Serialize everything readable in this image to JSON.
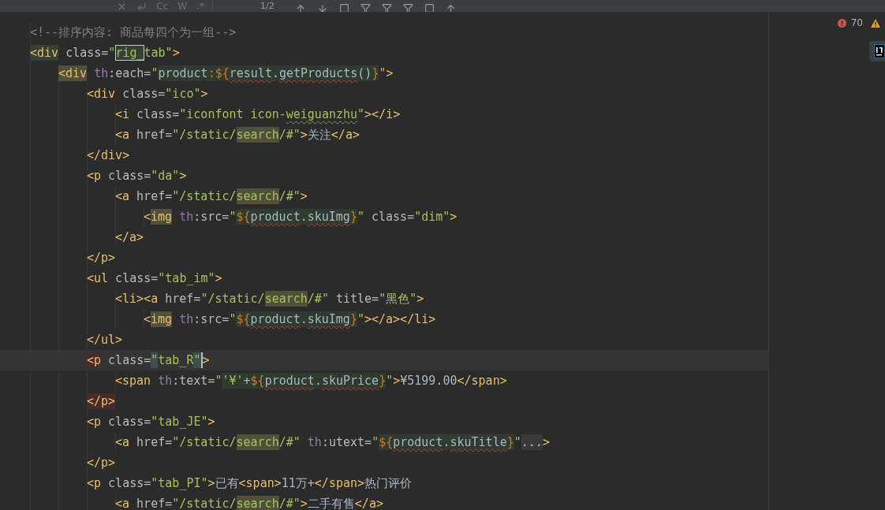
{
  "toolbar": {
    "options": [
      "Cc",
      "W",
      ".*"
    ],
    "match_count": "1/2"
  },
  "inspections": {
    "errors": "70"
  },
  "lines": [
    {
      "tokens": [
        {
          "kind": "comment",
          "text": "<!--排序内容: 商品每四个为一组-->"
        }
      ]
    },
    {
      "tokens": [
        {
          "kind": "tag",
          "text": "<div",
          "tag_match": true
        },
        {
          "kind": "attr",
          "text": " class="
        },
        {
          "kind": "str",
          "text": "\""
        },
        {
          "kind": "str",
          "text": "rig_",
          "boxed": true
        },
        {
          "kind": "str",
          "text": "tab\""
        },
        {
          "kind": "tag",
          "text": ">"
        }
      ],
      "children": [
        {
          "tokens": [
            {
              "kind": "tag",
              "text": "<div",
              "usage": true
            },
            {
              "kind": "ns",
              "text": " th"
            },
            {
              "kind": "attr",
              "text": ":each="
            },
            {
              "kind": "str",
              "text": "\""
            },
            {
              "kind": "expr",
              "text": "product",
              "injected": true
            },
            {
              "kind": "brace",
              "text": ":${",
              "injected": true
            },
            {
              "kind": "expr",
              "text": "result",
              "injected": true,
              "error_wave": true
            },
            {
              "kind": "expr",
              "text": ".",
              "injected": true
            },
            {
              "kind": "expr",
              "text": "getProducts",
              "injected": true,
              "error_wave": true
            },
            {
              "kind": "expr",
              "text": "()",
              "injected": true
            },
            {
              "kind": "brace",
              "text": "}",
              "injected": true
            },
            {
              "kind": "str",
              "text": "\""
            },
            {
              "kind": "tag",
              "text": ">"
            }
          ],
          "children": [
            {
              "tokens": [
                {
                  "kind": "tag",
                  "text": "<div"
                },
                {
                  "kind": "attr",
                  "text": " class="
                },
                {
                  "kind": "str",
                  "text": "\"ico\""
                },
                {
                  "kind": "tag",
                  "text": ">"
                }
              ],
              "children": [
                {
                  "tokens": [
                    {
                      "kind": "tag",
                      "text": "<i"
                    },
                    {
                      "kind": "attr",
                      "text": " class="
                    },
                    {
                      "kind": "str",
                      "text": "\"iconfont icon-"
                    },
                    {
                      "kind": "str",
                      "text": "weiguanzhu",
                      "typo_wave": true
                    },
                    {
                      "kind": "str",
                      "text": "\""
                    },
                    {
                      "kind": "tag",
                      "text": "></i>"
                    }
                  ]
                },
                {
                  "tokens": [
                    {
                      "kind": "tag",
                      "text": "<a"
                    },
                    {
                      "kind": "attr",
                      "text": " href="
                    },
                    {
                      "kind": "str",
                      "text": "\"/static/"
                    },
                    {
                      "kind": "str",
                      "text": "search",
                      "usage": true
                    },
                    {
                      "kind": "str",
                      "text": "/#\""
                    },
                    {
                      "kind": "tag",
                      "text": ">"
                    },
                    {
                      "kind": "text",
                      "text": "关注"
                    },
                    {
                      "kind": "tag",
                      "text": "</a>"
                    }
                  ]
                }
              ]
            },
            {
              "tokens": [
                {
                  "kind": "tag",
                  "text": "</div>"
                }
              ]
            },
            {
              "tokens": [
                {
                  "kind": "tag",
                  "text": "<p"
                },
                {
                  "kind": "attr",
                  "text": " class="
                },
                {
                  "kind": "str",
                  "text": "\"da\""
                },
                {
                  "kind": "tag",
                  "text": ">"
                }
              ],
              "children": [
                {
                  "tokens": [
                    {
                      "kind": "tag",
                      "text": "<a"
                    },
                    {
                      "kind": "attr",
                      "text": " href="
                    },
                    {
                      "kind": "str",
                      "text": "\"/static/"
                    },
                    {
                      "kind": "str",
                      "text": "search",
                      "usage": true
                    },
                    {
                      "kind": "str",
                      "text": "/#\""
                    },
                    {
                      "kind": "tag",
                      "text": ">"
                    }
                  ],
                  "children": [
                    {
                      "tokens": [
                        {
                          "kind": "tag",
                          "text": "<"
                        },
                        {
                          "kind": "tag",
                          "text": "img",
                          "usage": true
                        },
                        {
                          "kind": "ns",
                          "text": " th"
                        },
                        {
                          "kind": "attr",
                          "text": ":src="
                        },
                        {
                          "kind": "str",
                          "text": "\""
                        },
                        {
                          "kind": "brace",
                          "text": "${",
                          "injected": true
                        },
                        {
                          "kind": "expr",
                          "text": "product",
                          "injected": true,
                          "error_wave": true
                        },
                        {
                          "kind": "expr",
                          "text": ".",
                          "injected": true
                        },
                        {
                          "kind": "expr",
                          "text": "skuImg",
                          "injected": true,
                          "error_wave": true
                        },
                        {
                          "kind": "brace",
                          "text": "}",
                          "injected": true
                        },
                        {
                          "kind": "str",
                          "text": "\""
                        },
                        {
                          "kind": "attr",
                          "text": " class="
                        },
                        {
                          "kind": "str",
                          "text": "\"dim\""
                        },
                        {
                          "kind": "tag",
                          "text": ">"
                        }
                      ]
                    }
                  ]
                },
                {
                  "tokens": [
                    {
                      "kind": "tag",
                      "text": "</a>"
                    }
                  ]
                }
              ]
            },
            {
              "tokens": [
                {
                  "kind": "tag",
                  "text": "</p>"
                }
              ]
            },
            {
              "tokens": [
                {
                  "kind": "tag",
                  "text": "<ul"
                },
                {
                  "kind": "attr",
                  "text": " class="
                },
                {
                  "kind": "str",
                  "text": "\"tab_im\""
                },
                {
                  "kind": "tag",
                  "text": ">"
                }
              ],
              "children": [
                {
                  "tokens": [
                    {
                      "kind": "tag",
                      "text": "<li><a"
                    },
                    {
                      "kind": "attr",
                      "text": " href="
                    },
                    {
                      "kind": "str",
                      "text": "\"/static/"
                    },
                    {
                      "kind": "str",
                      "text": "search",
                      "usage": true
                    },
                    {
                      "kind": "str",
                      "text": "/#\""
                    },
                    {
                      "kind": "attr",
                      "text": " title="
                    },
                    {
                      "kind": "str",
                      "text": "\"黑色\""
                    },
                    {
                      "kind": "tag",
                      "text": ">"
                    }
                  ],
                  "children": [
                    {
                      "tokens": [
                        {
                          "kind": "tag",
                          "text": "<"
                        },
                        {
                          "kind": "tag",
                          "text": "img",
                          "usage": true
                        },
                        {
                          "kind": "ns",
                          "text": " th"
                        },
                        {
                          "kind": "attr",
                          "text": ":src="
                        },
                        {
                          "kind": "str",
                          "text": "\""
                        },
                        {
                          "kind": "brace",
                          "text": "${",
                          "injected": true
                        },
                        {
                          "kind": "expr",
                          "text": "product",
                          "injected": true,
                          "error_wave": true
                        },
                        {
                          "kind": "expr",
                          "text": ".",
                          "injected": true
                        },
                        {
                          "kind": "expr",
                          "text": "skuImg",
                          "injected": true,
                          "error_wave": true
                        },
                        {
                          "kind": "brace",
                          "text": "}",
                          "injected": true
                        },
                        {
                          "kind": "str",
                          "text": "\""
                        },
                        {
                          "kind": "tag",
                          "text": "></a></li>"
                        }
                      ]
                    }
                  ]
                }
              ]
            },
            {
              "tokens": [
                {
                  "kind": "tag",
                  "text": "</ul>"
                }
              ]
            },
            {
              "tokens": [
                {
                  "kind": "tag",
                  "text": "<p",
                  "pair_error": true
                },
                {
                  "kind": "attr",
                  "text": " class="
                },
                {
                  "kind": "str",
                  "text": "\"",
                  "quote_match": true
                },
                {
                  "kind": "str",
                  "text": "tab_R"
                },
                {
                  "kind": "str",
                  "text": "\"",
                  "quote_match": true,
                  "caret": true
                },
                {
                  "kind": "tag",
                  "text": ">"
                }
              ],
              "children": [
                {
                  "tokens": [
                    {
                      "kind": "tag",
                      "text": "<span"
                    },
                    {
                      "kind": "ns",
                      "text": " th"
                    },
                    {
                      "kind": "attr",
                      "text": ":text="
                    },
                    {
                      "kind": "str",
                      "text": "\""
                    },
                    {
                      "kind": "str",
                      "text": "'¥'",
                      "injected": true
                    },
                    {
                      "kind": "expr",
                      "text": "+",
                      "injected": true
                    },
                    {
                      "kind": "brace",
                      "text": "${",
                      "injected": true
                    },
                    {
                      "kind": "expr",
                      "text": "product",
                      "injected": true,
                      "error_wave": true
                    },
                    {
                      "kind": "expr",
                      "text": ".",
                      "injected": true
                    },
                    {
                      "kind": "expr",
                      "text": "skuPrice",
                      "injected": true,
                      "error_wave": true
                    },
                    {
                      "kind": "brace",
                      "text": "}",
                      "injected": true
                    },
                    {
                      "kind": "str",
                      "text": "\""
                    },
                    {
                      "kind": "tag",
                      "text": ">"
                    },
                    {
                      "kind": "text",
                      "text": "¥5199.00"
                    },
                    {
                      "kind": "tag",
                      "text": "</span>"
                    }
                  ]
                }
              ]
            },
            {
              "tokens": [
                {
                  "kind": "tag",
                  "text": "</p>",
                  "pair_error": true
                }
              ]
            },
            {
              "tokens": [
                {
                  "kind": "tag",
                  "text": "<p"
                },
                {
                  "kind": "attr",
                  "text": " class="
                },
                {
                  "kind": "str",
                  "text": "\"tab_JE\""
                },
                {
                  "kind": "tag",
                  "text": ">"
                }
              ],
              "children": [
                {
                  "tokens": [
                    {
                      "kind": "tag",
                      "text": "<a"
                    },
                    {
                      "kind": "attr",
                      "text": " href="
                    },
                    {
                      "kind": "str",
                      "text": "\"/static/"
                    },
                    {
                      "kind": "str",
                      "text": "search",
                      "usage": true
                    },
                    {
                      "kind": "str",
                      "text": "/#\""
                    },
                    {
                      "kind": "ns",
                      "text": " th"
                    },
                    {
                      "kind": "attr",
                      "text": ":utext="
                    },
                    {
                      "kind": "str",
                      "text": "\""
                    },
                    {
                      "kind": "brace",
                      "text": "${",
                      "injected": true
                    },
                    {
                      "kind": "expr",
                      "text": "product",
                      "injected": true,
                      "error_wave": true
                    },
                    {
                      "kind": "expr",
                      "text": ".",
                      "injected": true
                    },
                    {
                      "kind": "expr",
                      "text": "skuTitle",
                      "injected": true,
                      "error_wave": true
                    },
                    {
                      "kind": "brace",
                      "text": "}",
                      "injected": true
                    },
                    {
                      "kind": "str",
                      "text": "\""
                    },
                    {
                      "kind": "attr",
                      "text": "...",
                      "folded": true
                    },
                    {
                      "kind": "tag",
                      "text": ">"
                    }
                  ]
                }
              ]
            },
            {
              "tokens": [
                {
                  "kind": "tag",
                  "text": "</p>"
                }
              ]
            },
            {
              "tokens": [
                {
                  "kind": "tag",
                  "text": "<p"
                },
                {
                  "kind": "attr",
                  "text": " class="
                },
                {
                  "kind": "str",
                  "text": "\"tab_PI\""
                },
                {
                  "kind": "tag",
                  "text": ">"
                },
                {
                  "kind": "text",
                  "text": "已有"
                },
                {
                  "kind": "tag",
                  "text": "<span>"
                },
                {
                  "kind": "text",
                  "text": "11万+"
                },
                {
                  "kind": "tag",
                  "text": "</span>"
                },
                {
                  "kind": "text",
                  "text": "热门评价"
                }
              ],
              "children": [
                {
                  "tokens": [
                    {
                      "kind": "tag",
                      "text": "<a"
                    },
                    {
                      "kind": "attr",
                      "text": " href="
                    },
                    {
                      "kind": "str",
                      "text": "\"/static/"
                    },
                    {
                      "kind": "str",
                      "text": "search",
                      "usage": true
                    },
                    {
                      "kind": "str",
                      "text": "/#\""
                    },
                    {
                      "kind": "tag",
                      "text": ">"
                    },
                    {
                      "kind": "text",
                      "text": "二手有售"
                    },
                    {
                      "kind": "tag",
                      "text": "</a>"
                    }
                  ]
                }
              ]
            }
          ]
        }
      ]
    }
  ]
}
